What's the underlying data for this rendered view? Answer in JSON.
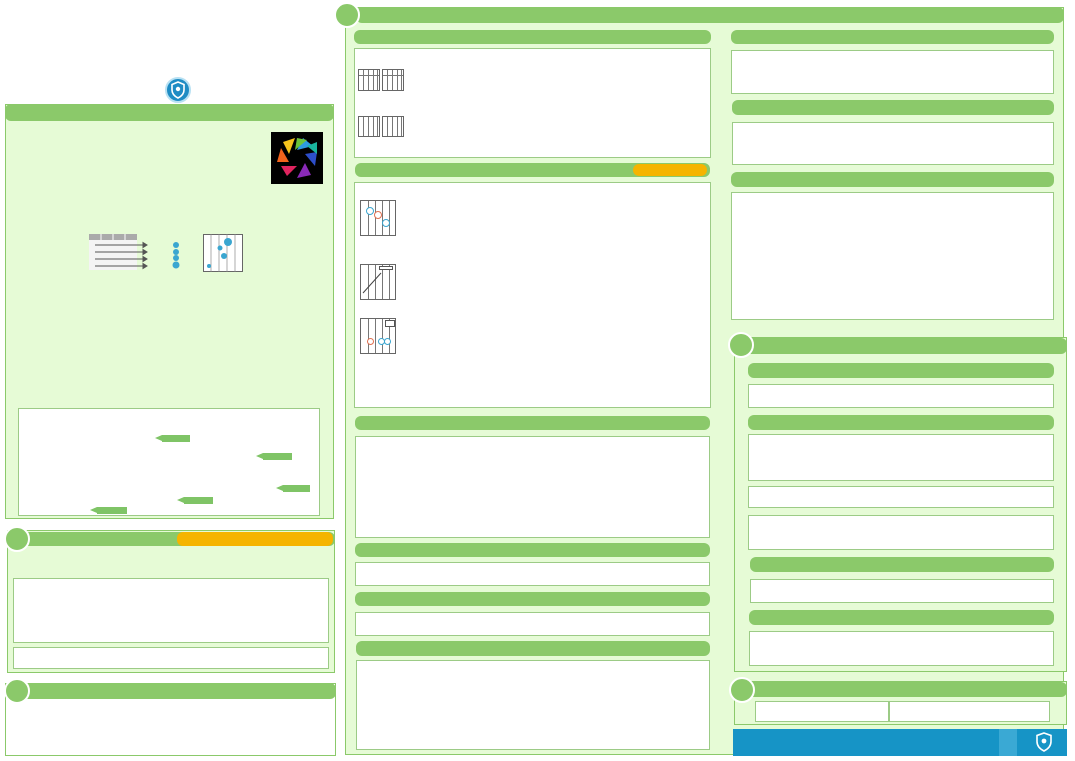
{
  "colors": {
    "panel_bg": "#e6fbd6",
    "header_green": "#8bc96a",
    "accent_orange": "#f5b400",
    "footer_blue": "#1694c6",
    "dot_blue": "#3aa6d0"
  },
  "icons": {
    "top_logo": "shield-hand-icon",
    "footer_logo": "shield-hand-icon",
    "main_logo": "color-wheel-logo-icon",
    "workflow": [
      "table-arrows-icon",
      "stacked-dots-icon",
      "scatter-plot-icon"
    ]
  }
}
